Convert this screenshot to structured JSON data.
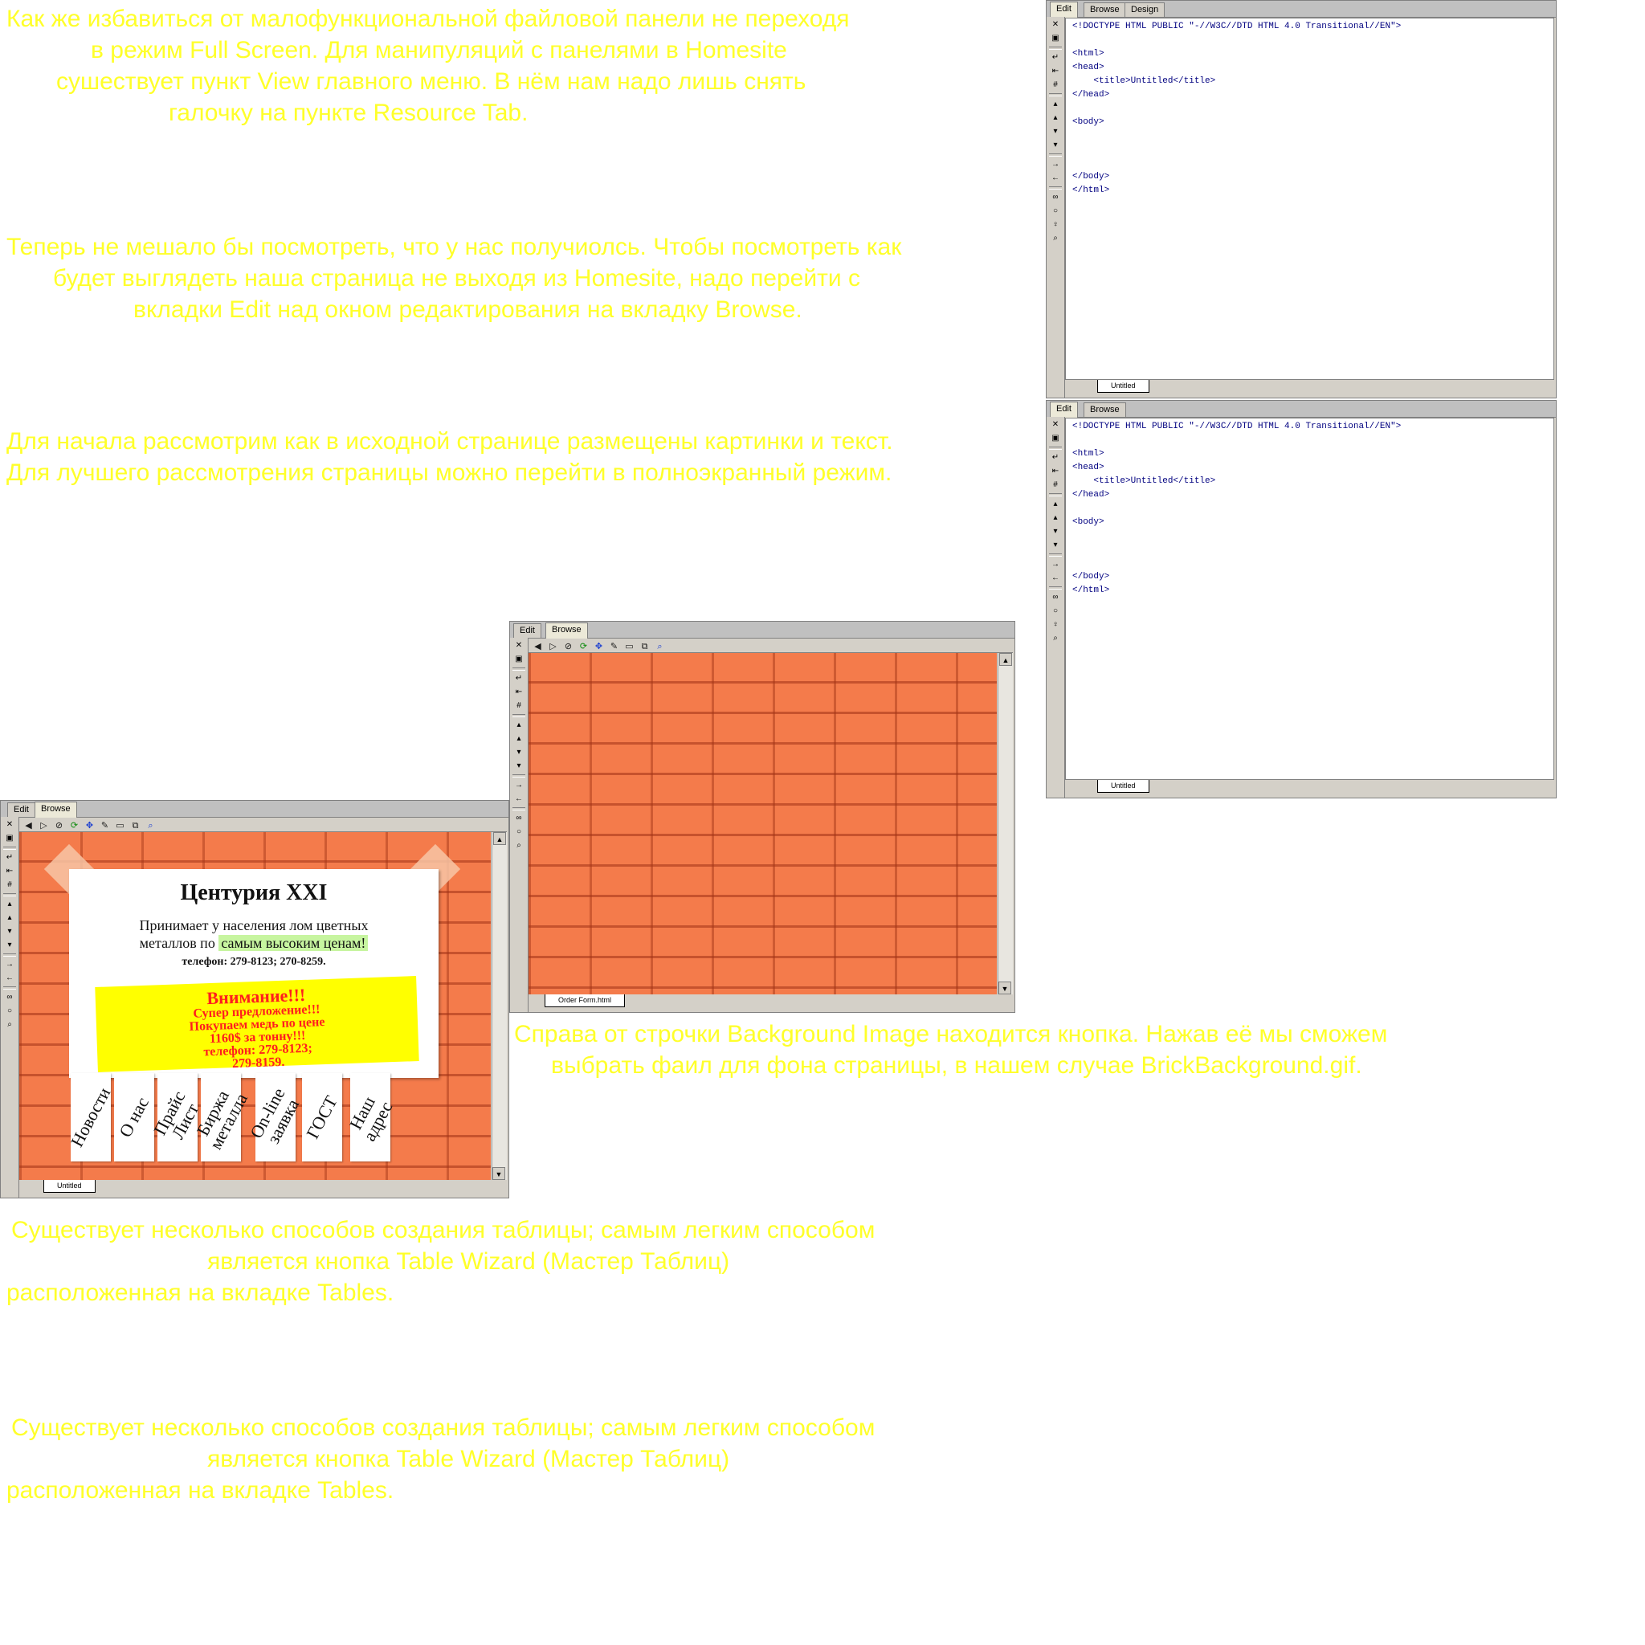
{
  "text_blocks": {
    "p1": [
      "Как же избавиться от малофункциональной файловой панели не переходя",
      "в режим Full Screen. Для манипуляций с панелями в Homesite",
      "сушествует пункт  View главного меню. В нём нам надо лишь снять",
      "галочку на пункте Resource Tab."
    ],
    "p2": [
      "Теперь не мешало бы посмотреть, что у нас получиолсь. Чтобы посмотреть как",
      "будет выглядеть наша страница не выходя из Homesite,  надо перейти с",
      "вкладки Edit  над окном редактирования на вкладку Browse."
    ],
    "p3": [
      "Для начала рассмотрим как в исходной странице размещены картинки и текст.",
      "Для лучшего рассмотрения страницы можно перейти в полноэкранный режим."
    ],
    "p4": [
      "Справа от строчки Background Image находится кнопка. Нажав её мы сможем",
      "выбрать фаил для фона страницы, в нашем случае BrickBackground.gif."
    ],
    "p5": [
      "Существует несколько способов создания таблицы; самым легким способом",
      "является кнопка Table Wizard (Мастер Таблиц)",
      "расположенная на вкладке Tables."
    ],
    "p6": [
      "Существует несколько способов создания таблицы; самым легким способом",
      "является кнопка Table Wizard (Мастер Таблиц)",
      "расположенная на вкладке Tables."
    ]
  },
  "colors": {
    "text": "#ffff2a",
    "brick": "#f47b4b",
    "chrome": "#d4d0c8",
    "code": "#000080"
  },
  "editor1": {
    "tabs": [
      "Edit",
      "Browse",
      "Design"
    ],
    "code": [
      "<!DOCTYPE HTML PUBLIC \"-//W3C//DTD HTML 4.0 Transitional//EN\">",
      "",
      "<html>",
      "<head>",
      "    <title>Untitled</title>",
      "</head>",
      "",
      "<body>",
      "",
      "",
      "",
      "</body>",
      "</html>"
    ],
    "doc_tab": "Untitled"
  },
  "editor2": {
    "tabs": [
      "Edit",
      "Browse"
    ],
    "code": [
      "<!DOCTYPE HTML PUBLIC \"-//W3C//DTD HTML 4.0 Transitional//EN\">",
      "",
      "<html>",
      "<head>",
      "    <title>Untitled</title>",
      "</head>",
      "",
      "<body>",
      "",
      "",
      "",
      "</body>",
      "</html>"
    ],
    "doc_tab": "Untitled"
  },
  "browser_mid": {
    "tabs": [
      "Edit",
      "Browse"
    ],
    "doc_tab": "Order Form.html"
  },
  "browser_left": {
    "tabs": [
      "Edit",
      "Browse"
    ],
    "doc_tab": "Untitled",
    "poster": {
      "title": "Центурия XXI",
      "line1": "Принимает у населения лом цветных",
      "line2a": "металлов по ",
      "line2b": "самым  высоким  ценам!",
      "phone": "телефон: 279-8123; 270-8259.",
      "note": [
        "Внимание!!!",
        "Супер предложение!!!",
        "Покупаем медь по цене",
        "1160$ за тонну!!!",
        "телефон: 279-8123;",
        "279-8159."
      ],
      "strips": [
        "Новости",
        "О нас",
        "Прайс\nЛист",
        "Биржа\nметалла",
        "On-line\nзаявка",
        "ГОСТ",
        "Наш\nадрес"
      ]
    }
  }
}
